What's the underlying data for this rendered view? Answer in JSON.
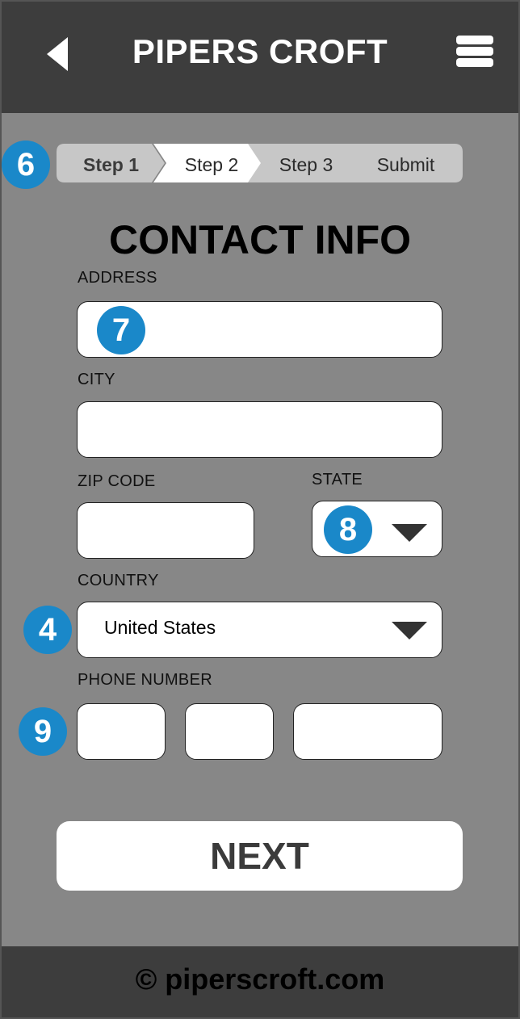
{
  "header": {
    "title": "PIPERS CROFT",
    "back_icon": "back-arrow-icon",
    "menu_icon": "hamburger-menu-icon",
    "background": "#3d3d3d"
  },
  "annotations": {
    "steps_marker": "6",
    "address_marker": "7",
    "state_marker": "8",
    "country_marker": "4",
    "phone_marker": "9",
    "color": "#1a88c9"
  },
  "steps": [
    {
      "label": "Step 1",
      "state": "current"
    },
    {
      "label": "Step 2",
      "state": "active"
    },
    {
      "label": "Step 3",
      "state": "pending"
    },
    {
      "label": "Submit",
      "state": "pending"
    }
  ],
  "form": {
    "heading": "CONTACT INFO",
    "address": {
      "label": "ADDRESS",
      "value": ""
    },
    "city": {
      "label": "CITY",
      "value": ""
    },
    "zip": {
      "label": "ZIP CODE",
      "value": ""
    },
    "state": {
      "label": "STATE",
      "value": ""
    },
    "country": {
      "label": "COUNTRY",
      "value": "United States"
    },
    "phone": {
      "label": "PHONE NUMBER",
      "values": [
        "",
        "",
        ""
      ]
    }
  },
  "actions": {
    "next_label": "NEXT"
  },
  "footer": {
    "text": "© piperscroft.com"
  }
}
